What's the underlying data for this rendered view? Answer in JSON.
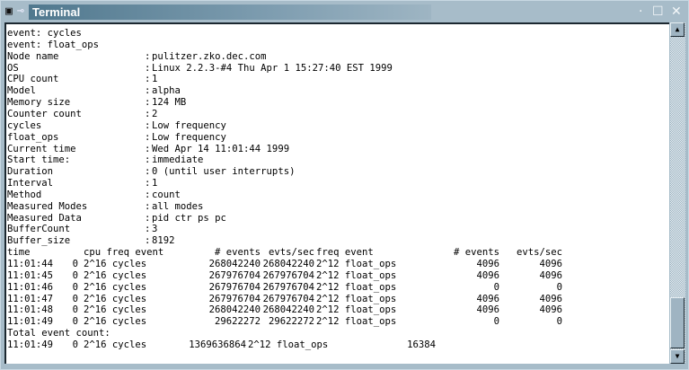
{
  "window": {
    "title": "Terminal"
  },
  "info": [
    {
      "text": "event: cycles"
    },
    {
      "text": "event: float_ops"
    },
    {
      "label": "Node name",
      "value": "pulitzer.zko.dec.com"
    },
    {
      "label": "OS",
      "value": "Linux 2.2.3-#4 Thu Apr 1 15:27:40 EST 1999"
    },
    {
      "label": "CPU count",
      "value": "1"
    },
    {
      "label": "Model",
      "value": "alpha"
    },
    {
      "label": "Memory size",
      "value": "124 MB"
    },
    {
      "label": "Counter count",
      "value": "2"
    },
    {
      "label": "cycles",
      "value": "Low frequency"
    },
    {
      "label": "float_ops",
      "value": "Low frequency"
    },
    {
      "label": "Current time",
      "value": "Wed Apr 14 11:01:44 1999"
    },
    {
      "label": "Start time:",
      "value": "immediate"
    },
    {
      "label": "Duration",
      "value": "0 (until user interrupts)"
    },
    {
      "label": "Interval",
      "value": "1"
    },
    {
      "label": "Method",
      "value": "count"
    },
    {
      "label": "Measured Modes",
      "value": "all modes"
    },
    {
      "label": "Measured Data",
      "value": "pid ctr ps pc"
    },
    {
      "label": "BufferCount",
      "value": "3"
    },
    {
      "label": "Buffer_size",
      "value": "8192"
    }
  ],
  "table": {
    "headers": [
      "time",
      "cpu freq event",
      "# events",
      "evts/sec",
      "freq event",
      "# events",
      "evts/sec"
    ],
    "rows": [
      [
        "11:01:44",
        "0",
        "2^16 cycles",
        "268042240",
        "268042240",
        "2^12 float_ops",
        "4096",
        "4096"
      ],
      [
        "11:01:45",
        "0",
        "2^16 cycles",
        "267976704",
        "267976704",
        "2^12 float_ops",
        "4096",
        "4096"
      ],
      [
        "11:01:46",
        "0",
        "2^16 cycles",
        "267976704",
        "267976704",
        "2^12 float_ops",
        "0",
        "0"
      ],
      [
        "11:01:47",
        "0",
        "2^16 cycles",
        "267976704",
        "267976704",
        "2^12 float_ops",
        "4096",
        "4096"
      ],
      [
        "11:01:48",
        "0",
        "2^16 cycles",
        "268042240",
        "268042240",
        "2^12 float_ops",
        "4096",
        "4096"
      ],
      [
        "11:01:49",
        "0",
        "2^16 cycles",
        "29622272",
        "29622272",
        "2^12 float_ops",
        "0",
        "0"
      ]
    ],
    "total_label": "Total event count:",
    "total": [
      "11:01:49",
      "0",
      "2^16 cycles",
      "1369636864",
      "2^12 float_ops",
      "16384"
    ]
  },
  "scrollbar": {
    "position_fraction": 1.0
  }
}
